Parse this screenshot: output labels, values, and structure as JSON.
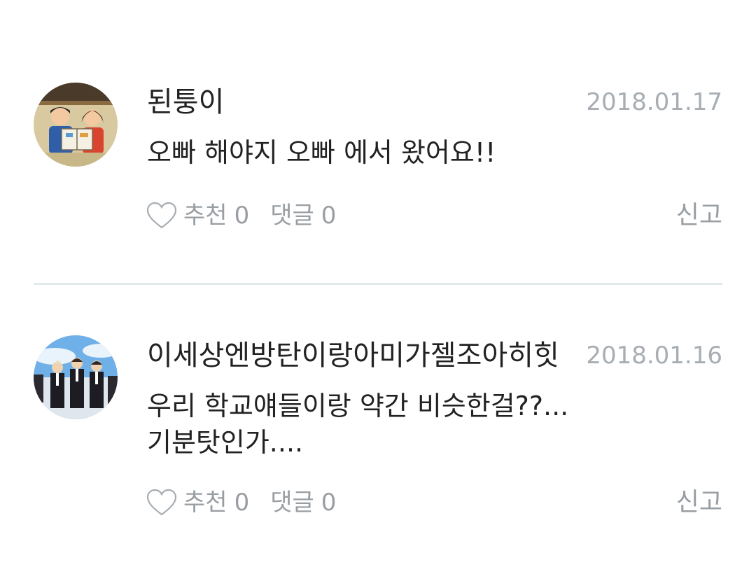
{
  "comments": [
    {
      "username": "된퉁이",
      "date": "2018.01.17",
      "text": "오빠 해야지 오빠 에서 왔어요!!",
      "like_label": "추천",
      "like_count": "0",
      "reply_label": "댓글",
      "reply_count": "0",
      "report_label": "신고",
      "avatar_icon": "retro-illustration-avatar"
    },
    {
      "username": "이세상엔방탄이랑아미가젤조아히힛",
      "date": "2018.01.16",
      "text": "우리 학교얘들이랑 약간 비슷한걸??...기분탓인가....",
      "like_label": "추천",
      "like_count": "0",
      "reply_label": "댓글",
      "reply_count": "0",
      "report_label": "신고",
      "avatar_icon": "group-photo-avatar"
    }
  ],
  "colors": {
    "text": "#222222",
    "muted": "#999ea3",
    "date": "#a7adb2",
    "divider": "#e4e9ec"
  }
}
